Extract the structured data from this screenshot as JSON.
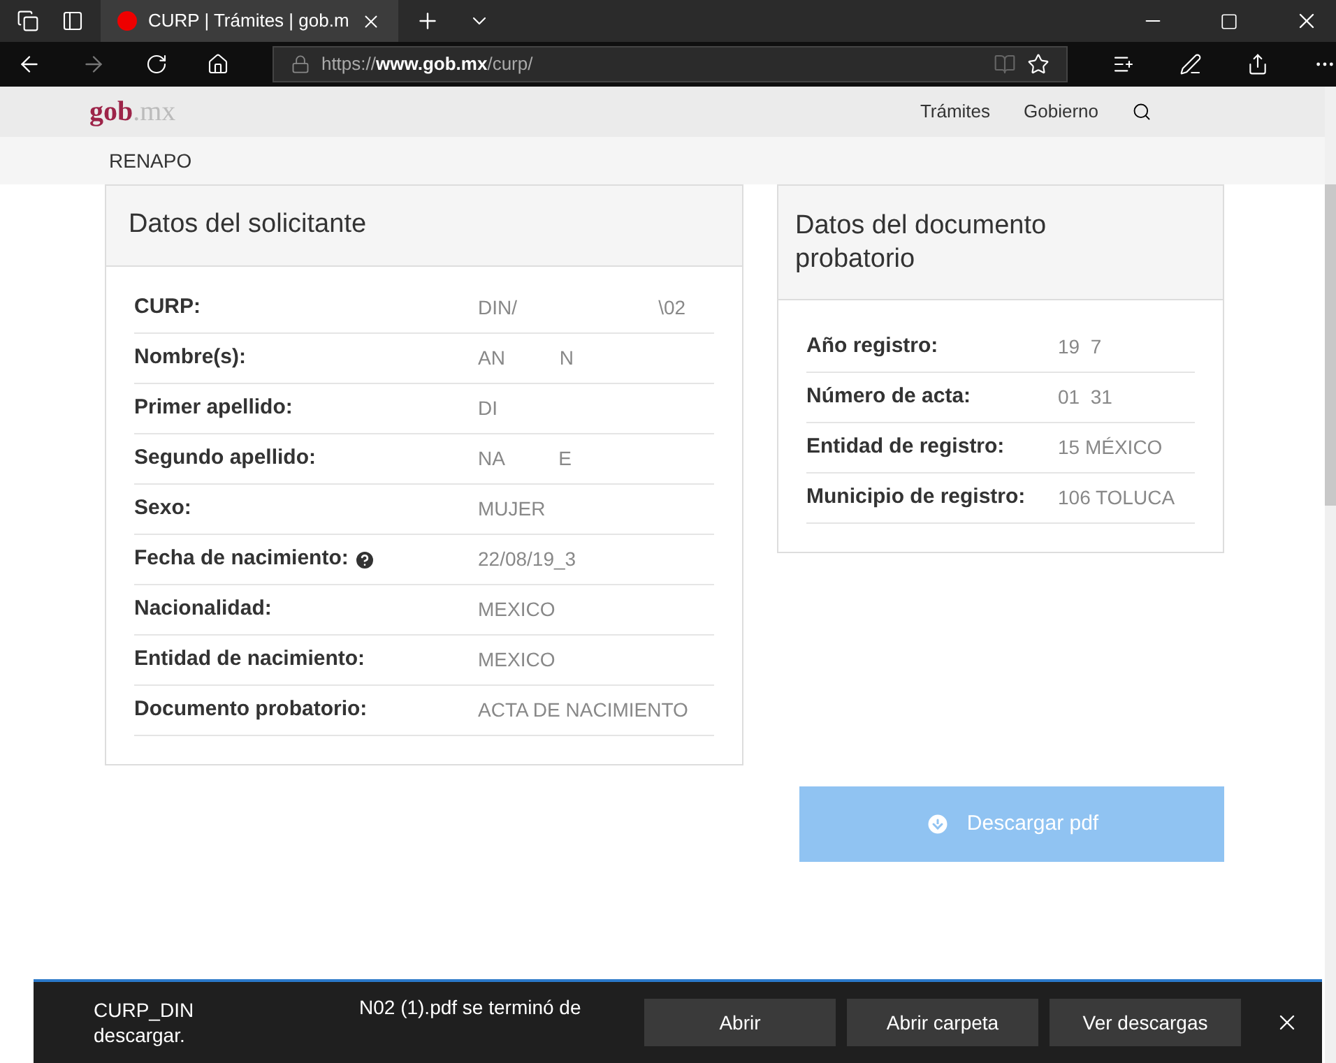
{
  "browser": {
    "tab": {
      "title": "CURP | Trámites | gob.m",
      "selected": true
    },
    "url_prefix": "https://",
    "url_host": "www.gob.mx",
    "url_path": "/curp/"
  },
  "site_header": {
    "logo_main": "gob",
    "logo_suffix": ".mx",
    "nav": [
      "Trámites",
      "Gobierno"
    ]
  },
  "breadcrumb": "RENAPO",
  "solicitante": {
    "title": "Datos del solicitante",
    "rows": [
      {
        "label": "CURP:",
        "value": "DIN/                          \\02"
      },
      {
        "label": "Nombre(s):",
        "value": "AN          N"
      },
      {
        "label": "Primer apellido:",
        "value": "DI"
      },
      {
        "label": "Segundo apellido:",
        "value": "NA          E"
      },
      {
        "label": "Sexo:",
        "value": "MUJER"
      },
      {
        "label": "Fecha de nacimiento:",
        "value": "22/08/19_3",
        "help": true
      },
      {
        "label": "Nacionalidad:",
        "value": "MEXICO"
      },
      {
        "label": "Entidad de nacimiento:",
        "value": "MEXICO"
      },
      {
        "label": "Documento probatorio:",
        "value": "ACTA DE NACIMIENTO"
      }
    ]
  },
  "documento": {
    "title": "Datos del documento probatorio",
    "rows": [
      {
        "label": "Año registro:",
        "value": "19  7"
      },
      {
        "label": "Número de acta:",
        "value": "01  31"
      },
      {
        "label": "Entidad de registro:",
        "value": "15 MÉXICO"
      },
      {
        "label": "Municipio de registro:",
        "value": "106 TOLUCA"
      }
    ]
  },
  "download_button": {
    "label": "Descargar pdf",
    "disabled": true
  },
  "download_bar": {
    "message_start": "CURP_DIN descargar.",
    "message_end": "N02 (1).pdf se terminó de",
    "buttons": [
      "Abrir",
      "Abrir carpeta",
      "Ver descargas"
    ]
  }
}
